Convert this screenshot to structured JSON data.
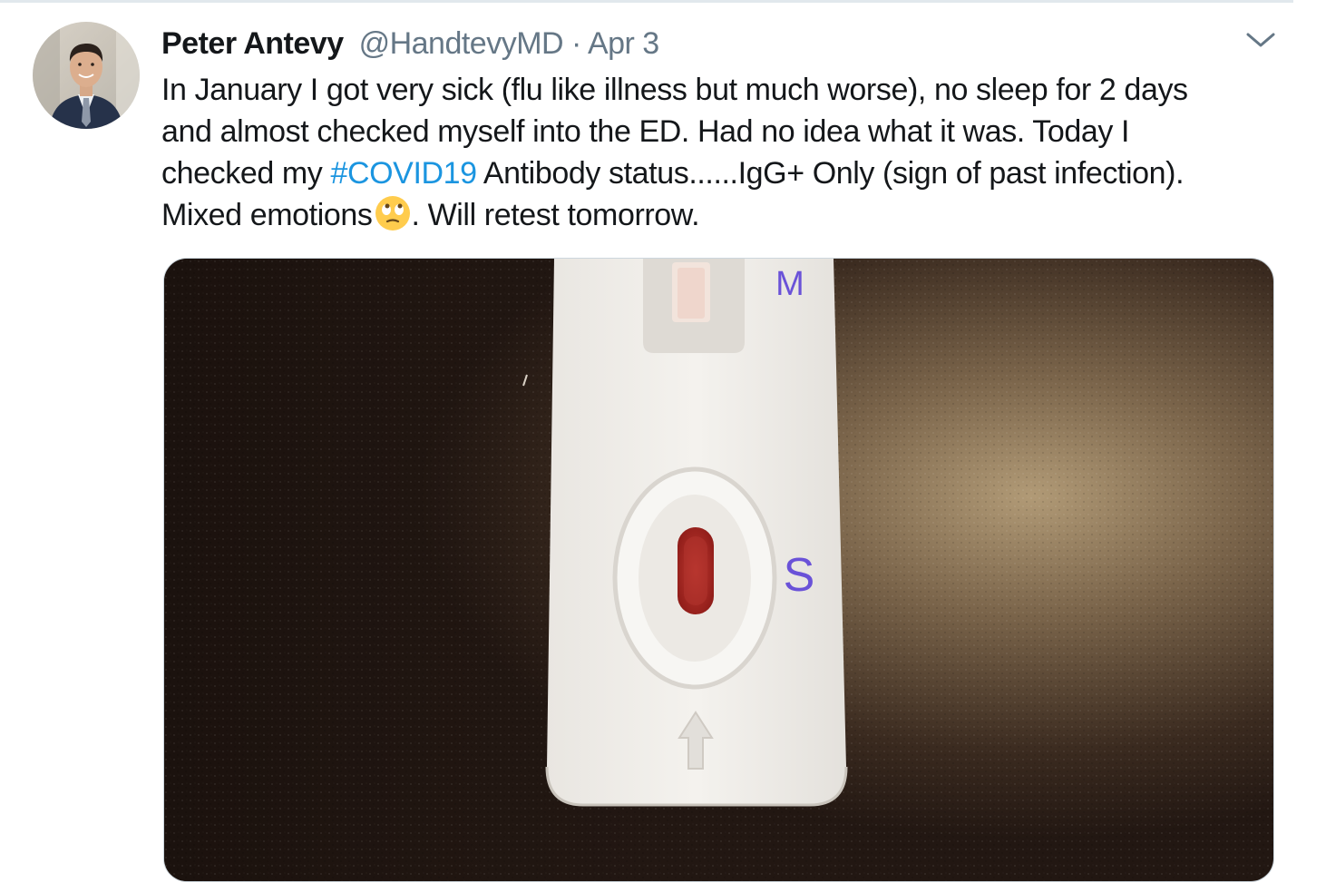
{
  "tweet": {
    "display_name": "Peter Antevy",
    "handle": "@HandtevyMD",
    "separator": "·",
    "date": "Apr 3",
    "text_line_1": "In January I got very sick (flu like illness but much worse), no sleep for 2 days",
    "text_line_2": "and almost checked myself into the ED.  Had no idea what it was.  Today I",
    "text_line_3_pre": "checked my ",
    "hashtag": "#COVID19",
    "text_line_3_post": " Antibody status......IgG+ Only (sign of past infection).",
    "text_line_4_pre": "Mixed emotions",
    "text_line_4_post": ".  Will retest tomorrow.",
    "emoji": "face-with-rolling-eyes",
    "colors": {
      "name": "#14171a",
      "secondary": "#657786",
      "hashtag": "#1b95e0",
      "border": "#e1e8ed"
    }
  },
  "media": {
    "label_m": "M",
    "label_s": "S",
    "description_icon": "antibody-test-cassette-photo"
  },
  "icons": {
    "avatar": "user-avatar",
    "menu": "chevron-down-icon"
  }
}
